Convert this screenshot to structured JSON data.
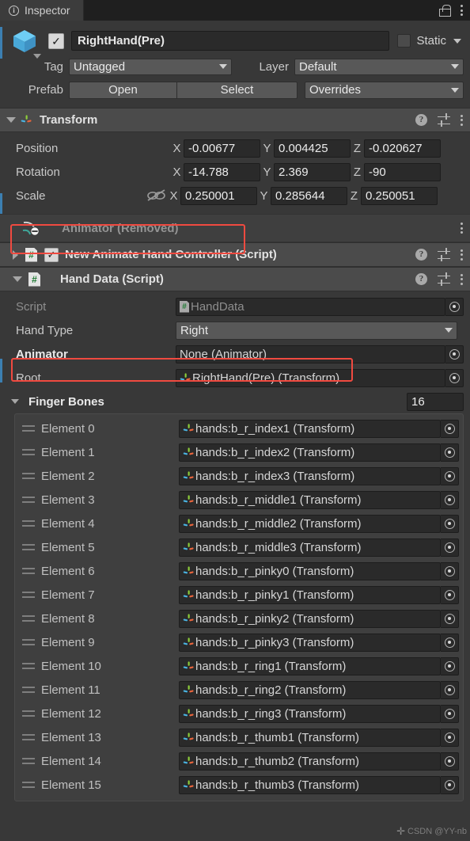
{
  "window": {
    "tab_label": "Inspector",
    "tab_icon": "info-icon",
    "lock_icon": "lock-open-icon",
    "menu_icon": "kebab-menu-icon"
  },
  "object_header": {
    "prefab_icon": "prefab-cube-icon",
    "enabled_checkbox": "✓",
    "name": "RightHand(Pre)",
    "static_label": "Static",
    "static_checked": false,
    "tag_label": "Tag",
    "tag_value": "Untagged",
    "layer_label": "Layer",
    "layer_value": "Default",
    "prefab_label": "Prefab",
    "open_button": "Open",
    "select_button": "Select",
    "overrides_button": "Overrides"
  },
  "transform": {
    "title": "Transform",
    "icon": "transform-gizmo-icon",
    "help_icon": "help-icon",
    "preset_icon": "preset-settings-icon",
    "menu_icon": "kebab-menu-icon",
    "rows": [
      {
        "label": "Position",
        "x": "-0.00677",
        "y": "0.004425",
        "z": "-0.020627",
        "link_icon": null
      },
      {
        "label": "Rotation",
        "x": "-14.788",
        "y": "2.369",
        "z": "-90",
        "link_icon": null
      },
      {
        "label": "Scale",
        "x": "0.250001",
        "y": "0.285644",
        "z": "0.250051",
        "link_icon": "constrain-proportions-off-icon"
      }
    ],
    "axis_labels": {
      "x": "X",
      "y": "Y",
      "z": "Z"
    }
  },
  "animator_removed": {
    "title": "Animator (Removed)",
    "icon": "animator-removed-icon",
    "menu_icon": "kebab-menu-icon",
    "highlighted": true
  },
  "hand_controller": {
    "title": "New Animate Hand Controller (Script)",
    "icon": "script-icon",
    "icon_glyph": "#",
    "enabled_checkbox": "✓",
    "expanded": false,
    "help_icon": "help-icon",
    "preset_icon": "preset-settings-icon",
    "menu_icon": "kebab-menu-icon"
  },
  "hand_data": {
    "title": "Hand Data (Script)",
    "icon": "script-icon",
    "icon_glyph": "#",
    "expanded": true,
    "help_icon": "help-icon",
    "preset_icon": "preset-settings-icon",
    "menu_icon": "kebab-menu-icon",
    "properties": {
      "script_label": "Script",
      "script_value": "HandData",
      "hand_type_label": "Hand Type",
      "hand_type_value": "Right",
      "animator_label": "Animator",
      "animator_value": "None (Animator)",
      "animator_highlighted": true,
      "root_label": "Root",
      "root_value": "RightHand(Pre) (Transform)"
    },
    "finger_bones": {
      "label": "Finger Bones",
      "size": "16",
      "expanded": true,
      "elements": [
        {
          "label": "Element 0",
          "value": "hands:b_r_index1 (Transform)"
        },
        {
          "label": "Element 1",
          "value": "hands:b_r_index2 (Transform)"
        },
        {
          "label": "Element 2",
          "value": "hands:b_r_index3 (Transform)"
        },
        {
          "label": "Element 3",
          "value": "hands:b_r_middle1 (Transform)"
        },
        {
          "label": "Element 4",
          "value": "hands:b_r_middle2 (Transform)"
        },
        {
          "label": "Element 5",
          "value": "hands:b_r_middle3 (Transform)"
        },
        {
          "label": "Element 6",
          "value": "hands:b_r_pinky0 (Transform)"
        },
        {
          "label": "Element 7",
          "value": "hands:b_r_pinky1 (Transform)"
        },
        {
          "label": "Element 8",
          "value": "hands:b_r_pinky2 (Transform)"
        },
        {
          "label": "Element 9",
          "value": "hands:b_r_pinky3 (Transform)"
        },
        {
          "label": "Element 10",
          "value": "hands:b_r_ring1 (Transform)"
        },
        {
          "label": "Element 11",
          "value": "hands:b_r_ring2 (Transform)"
        },
        {
          "label": "Element 12",
          "value": "hands:b_r_ring3 (Transform)"
        },
        {
          "label": "Element 13",
          "value": "hands:b_r_thumb1 (Transform)"
        },
        {
          "label": "Element 14",
          "value": "hands:b_r_thumb2 (Transform)"
        },
        {
          "label": "Element 15",
          "value": "hands:b_r_thumb3 (Transform)"
        }
      ]
    }
  },
  "watermark": {
    "text": "CSDN @YY-nb"
  },
  "colors": {
    "background": "#383838",
    "header_band": "#4b4b4b",
    "field": "#2a2a2a",
    "dropdown": "#585858",
    "accent_blue": "#3c7fb1",
    "annotation_red": "#f04a40",
    "script_green": "#1f7a33"
  }
}
